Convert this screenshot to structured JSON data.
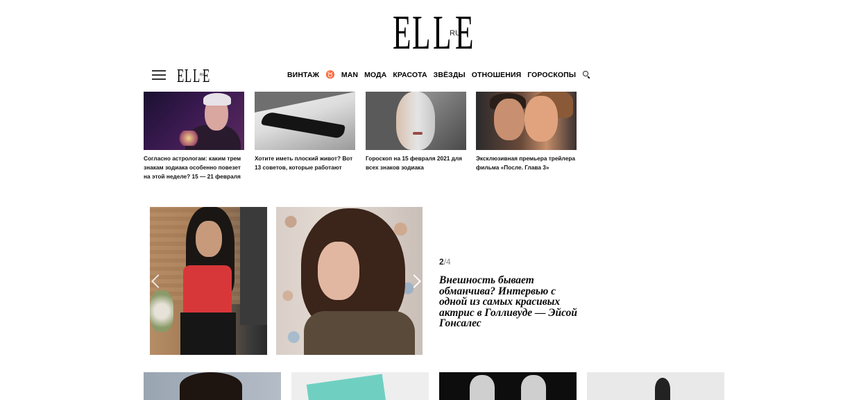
{
  "site": {
    "logo_main": "ELLE",
    "logo_region": "RU"
  },
  "nav": {
    "items": [
      "ВИНТАЖ",
      "♉",
      "MAN",
      "МОДА",
      "КРАСОТА",
      "ЗВЁЗДЫ",
      "ОТНОШЕНИЯ",
      "ГОРОСКОПЫ"
    ]
  },
  "cards": [
    {
      "title": "Согласно астрологам: каким трем знакам зодиака особенно повезет на этой неделе? 15 — 21 февраля"
    },
    {
      "title": "Хотите иметь плоский живот? Вот 13 советов, которые работают"
    },
    {
      "title": "Гороскоп на 15 февраля 2021 для всех знаков зодиака"
    },
    {
      "title": "Эксклюзивная премьера трейлера фильма «После. Глава 3»"
    }
  ],
  "feature": {
    "current": "2",
    "separator": "/",
    "total": "4",
    "headline": "Внешность бывает обманчива? Интервью с одной из самых красивых актрис в Голливуде — Эйсой Гонсалес"
  }
}
